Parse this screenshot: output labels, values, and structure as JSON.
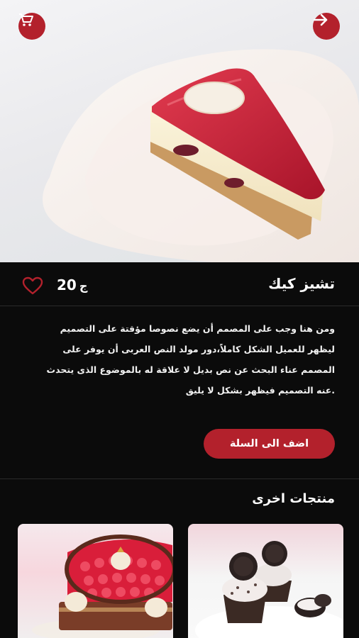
{
  "header": {
    "cart_icon": "cart-icon",
    "next_icon": "arrow-right-icon",
    "plaque_text_line1": "",
    "plaque_text_line2": ""
  },
  "product": {
    "name": "تشيز كيك",
    "price": "20",
    "currency": "ج",
    "favorite_icon": "heart-outline-icon",
    "description_lines": [
      "ومن هنا وجب على المصمم أن يضع نصوصا مؤقتة على التصميم",
      "ليظهر للعميل الشكل كاملاً،دور مولد النص العربى أن يوفر على",
      "المصمم عناء البحث عن نص بديل لا علاقة له بالموضوع الذى يتحدث",
      ".عنه التصميم فيظهر بشكل لا يليق"
    ],
    "add_to_cart_label": "اضف الى السلة"
  },
  "others": {
    "title": "منتجات اخرى"
  },
  "colors": {
    "accent": "#b3212c",
    "background": "#0b0b0b",
    "text": "#ffffff"
  }
}
